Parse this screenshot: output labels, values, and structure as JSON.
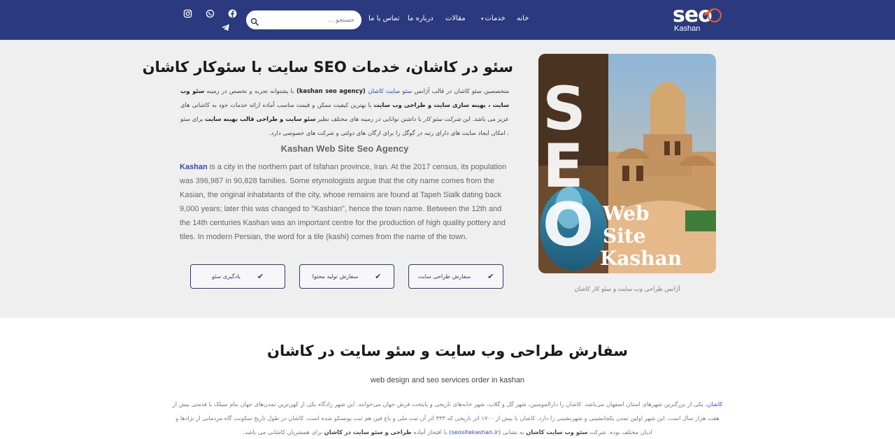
{
  "header": {
    "logo_text": "seo",
    "logo_sub": "Kashan",
    "nav": {
      "home": "خانه",
      "services": "خدمات",
      "articles": "مقالات",
      "about": "درباره ما",
      "contact": "تماس با ما"
    },
    "search_placeholder": "جستجو ...",
    "social": [
      "instagram-icon",
      "whatsapp-icon",
      "facebook-icon",
      "telegram-icon"
    ]
  },
  "hero": {
    "title": "سئو در کاشان، خدمات SEO سایت با سئوکار کاشان",
    "fa_intro": "متخصصین سئو کاشان در قالب آژانس ",
    "fa_link": "سئو سایت کاشان",
    "fa_agency": " (kashan seo agency) ",
    "fa_body1": "با پشتوانه تجربه و تخصص در زمینه ",
    "fa_bold1": "سئو وب سایت ، بهینه سازی سایت و طراحی وب سایت",
    "fa_body2": " با بهترین کیفیت ممکن و قیمت مناسب آماده ارائه خدمات خود به کاشانی های عزیز می باشد. این ",
    "fa_italic": "شرکت سئو کار",
    "fa_body3": " با داشتن توانایی در زمینه  های مختلف نظیر ",
    "fa_bold2": "سئو سایت و طراحی قالب بهینه سایت",
    "fa_body4": " برای سئو ، امکان ایجاد سایت های دارای رتبه در گوگل را برای ارگان های دولتی و شرکت های خصوصی دارد.",
    "subtitle": "Kashan Web Site Seo Agency",
    "en_link": "Kashan",
    "en_body": " is a city in the northern part of Isfahan province, Iran. At the 2017 census, its population was 396,987 in 90,828 families. Some etymologists argue that the city name comes from the Kasian, the original inhabitants of the city, whose remains are found at Tapeh Sialk dating back 9,000 years; later this was changed to \"Kashian\", hence the town name. Between the 12th and the 14th centuries Kashan was an important centre for the production of high quality pottery and tiles. In modern Persian, the word for a tile (kashi) comes from the name of the town.",
    "buttons": [
      "سفارش طراحی سایت",
      "سفارش تولید محتوا",
      "یادگیری سئو"
    ],
    "image_letters": [
      "S",
      "E",
      "O"
    ],
    "image_words": [
      "Web",
      "Site",
      "Kashan"
    ],
    "caption": "آژانس طراحی وب سایت و سئو کار کاشان"
  },
  "section": {
    "title": "سفارش طراحی وب سایت و سئو سایت در کاشان",
    "subtitle": "web design and seo services order in kashan",
    "link1": "کاشان",
    "body1": "، یکی از بزرگترین شهرهای استان اصفهان می‌باشد. کاشان را دارالمومنین، شهر گل و گلاب، شهر خانه‌های تاریخی و پایتخت فرش جهان می‌خوانند. این شهر زادگاه یکی از کهن‌ترین تمدن‌های جهان بنام سیلک با قدمتی بیش از هفت هزار سال است. این شهر اولین تمدن یکجانشینی و شهرنشینی را دارد. کاشان با بیش از ۱۷۰۰ اثر تاریخی که ۳۳۳ اثر آن ثبت ملی و باغ فین هم ثبت یونسکو شده است. کاشان در طول تاریخ سکونت گاه مردمانی از نژادها و ادیان مختلف بوده. شرکت ",
    "bold1": "سئو وب سایت کاشان",
    "body2": " به نشانی ",
    "link2": "(seositekashan.ir)",
    "body3": " با افتخار آماده ",
    "bold2": "طراحی و سئو سایت در کاشان",
    "body4": " برای همشریان کاشانی می باشد."
  },
  "colors": {
    "header_bg": "#2b3a7e",
    "accent": "#e85b2a",
    "link": "#2e46c4"
  }
}
